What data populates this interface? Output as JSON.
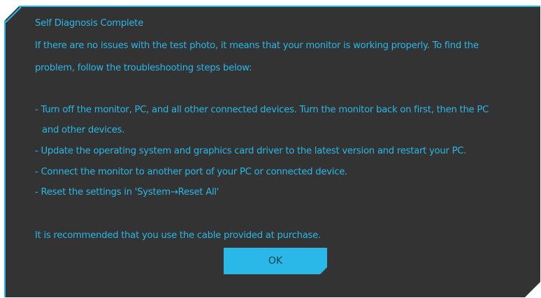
{
  "dialog": {
    "title": "Self Diagnosis Complete",
    "intro_line_1": "If there are no issues with the test photo, it means that your monitor is working properly. To find the",
    "intro_line_2": "problem, follow the troubleshooting steps below:",
    "steps": [
      "- Turn off the monitor, PC, and all other connected devices. Turn the monitor back on first, then the PC",
      "  and other devices.",
      "- Update the operating system and graphics card driver to the latest version and restart your PC.",
      "- Connect the monitor to another port of your PC or connected device.",
      "- Reset the settings in 'System→Reset All'"
    ],
    "recommendation": "It is recommended that you use the cable provided at purchase.",
    "ok_label": "OK"
  },
  "colors": {
    "accent": "#29b8e8",
    "background": "#333333",
    "button_text": "#1d3f4d"
  }
}
